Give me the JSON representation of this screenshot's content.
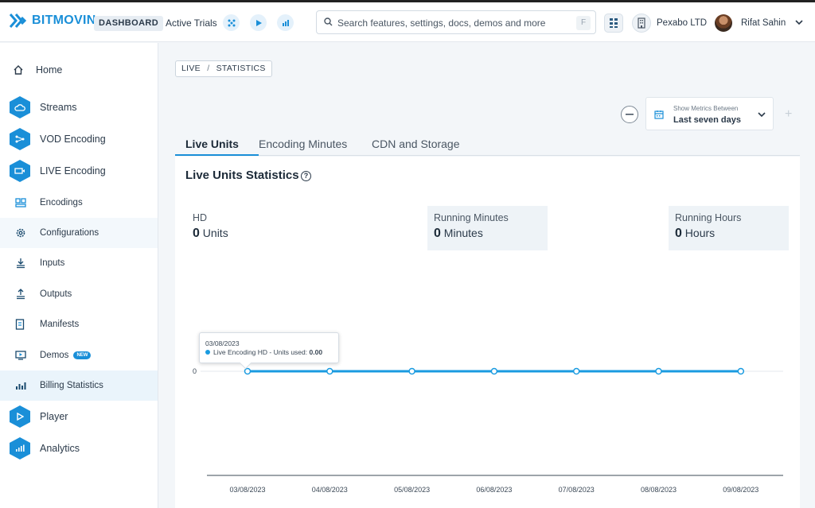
{
  "header": {
    "brand": "BITMOVIN",
    "badge": "DASHBOARD",
    "active_trials": "Active Trials",
    "trial_icons": [
      "encoding-icon",
      "player-icon",
      "analytics-icon"
    ],
    "search": {
      "placeholder": "Search features, settings, docs, demos and more",
      "shortcut": "F"
    },
    "org": "Pexabo LTD",
    "user": "Rifat Sahin"
  },
  "sidebar": {
    "items": [
      {
        "label": "Home",
        "icon": "home-icon"
      },
      {
        "label": "Streams",
        "icon": "cloud-icon"
      },
      {
        "label": "VOD Encoding",
        "icon": "encoding-icon"
      },
      {
        "label": "LIVE Encoding",
        "icon": "live-icon"
      },
      {
        "label": "Encodings",
        "icon": "encodings-icon"
      },
      {
        "label": "Configurations",
        "icon": "gear-icon"
      },
      {
        "label": "Inputs",
        "icon": "inputs-icon"
      },
      {
        "label": "Outputs",
        "icon": "outputs-icon"
      },
      {
        "label": "Manifests",
        "icon": "manifest-icon"
      },
      {
        "label": "Demos",
        "icon": "demos-icon",
        "badge": "NEW"
      },
      {
        "label": "Billing Statistics",
        "icon": "bar-chart-icon"
      },
      {
        "label": "Player",
        "icon": "play-icon"
      },
      {
        "label": "Analytics",
        "icon": "analytics-icon"
      }
    ]
  },
  "breadcrumb": {
    "part1": "LIVE",
    "sep": "/",
    "part2": "STATISTICS"
  },
  "metrics": {
    "caption": "Show Metrics Between",
    "value": "Last seven days"
  },
  "tabs": [
    "Live Units",
    "Encoding Minutes",
    "CDN and Storage"
  ],
  "panel": {
    "title": "Live Units Statistics",
    "stats": [
      {
        "label": "HD",
        "value": "0",
        "unit": "Units"
      },
      {
        "label": "Running Minutes",
        "value": "0",
        "unit": "Minutes"
      },
      {
        "label": "Running Hours",
        "value": "0",
        "unit": "Hours"
      }
    ]
  },
  "tooltip": {
    "date": "03/08/2023",
    "label": "Live Encoding HD - Units used:",
    "value": "0.00"
  },
  "chart_data": {
    "type": "line",
    "x": [
      "03/08/2023",
      "04/08/2023",
      "05/08/2023",
      "06/08/2023",
      "07/08/2023",
      "08/08/2023",
      "09/08/2023"
    ],
    "series": [
      {
        "name": "Live Encoding HD",
        "values": [
          0,
          0,
          0,
          0,
          0,
          0,
          0
        ]
      }
    ],
    "yticks": [
      "0"
    ],
    "color": "#1a9be0"
  },
  "colors": {
    "accent": "#1a8fd8",
    "line": "#1a9be0"
  }
}
